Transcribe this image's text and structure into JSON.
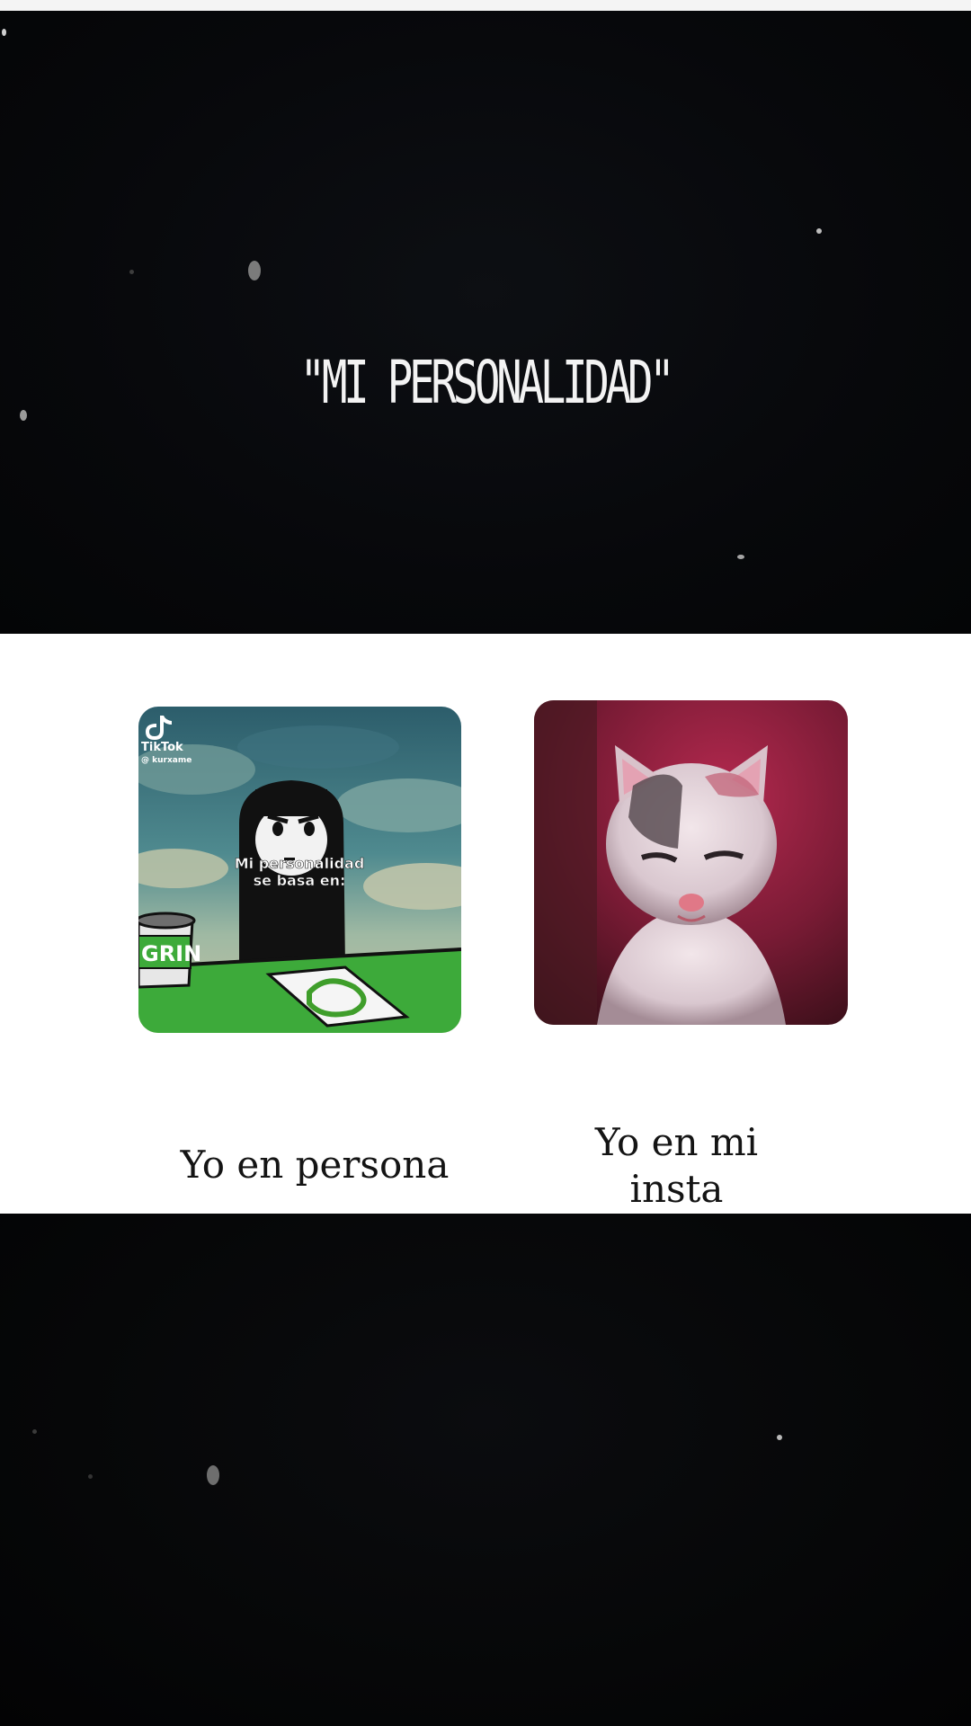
{
  "title": "\"MI PERSONALIDAD\"",
  "left_meme": {
    "watermark_app": "TikTok",
    "watermark_user": "@ kurxame",
    "overlay_text_line1": "Mi personalidad",
    "overlay_text_line2": "se basa en:",
    "cup_label": "GRIN",
    "caption": "Yo en persona"
  },
  "right_meme": {
    "caption_line1": "Yo en mi",
    "caption_line2": "insta"
  }
}
